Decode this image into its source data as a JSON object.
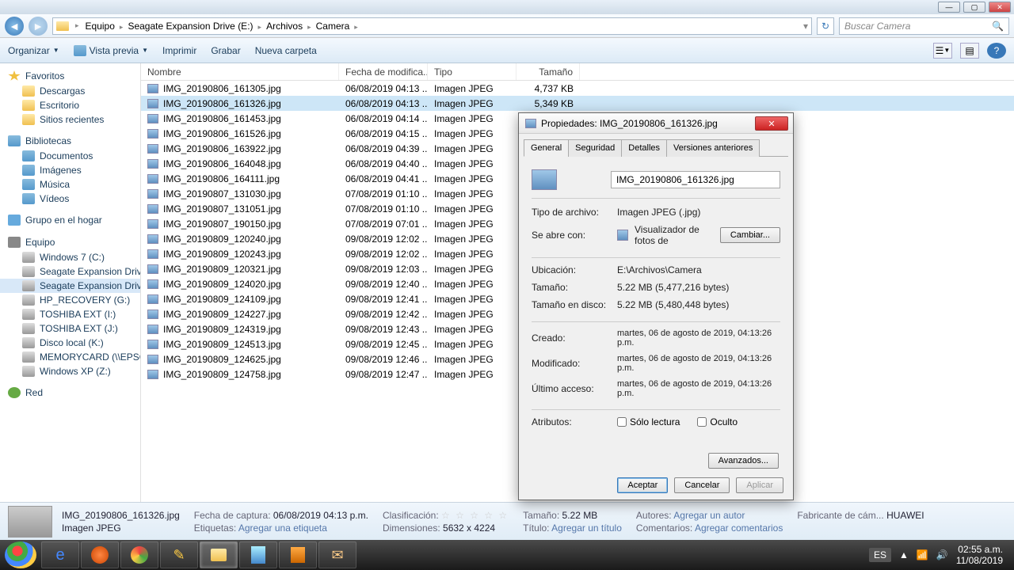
{
  "window": {
    "minimize": "—",
    "maximize": "▢",
    "close": "✕"
  },
  "nav": {
    "back": "◄",
    "fwd": "►",
    "refresh": "↻",
    "search_placeholder": "Buscar Camera",
    "search_icon": "🔍",
    "crumbs": [
      "Equipo",
      "Seagate Expansion Drive (E:)",
      "Archivos",
      "Camera"
    ]
  },
  "toolbar": {
    "organize": "Organizar",
    "preview": "Vista previa",
    "print": "Imprimir",
    "burn": "Grabar",
    "newfolder": "Nueva carpeta",
    "help": "?"
  },
  "sidebar": {
    "favorites": "Favoritos",
    "fav_items": [
      "Descargas",
      "Escritorio",
      "Sitios recientes"
    ],
    "libraries": "Bibliotecas",
    "lib_items": [
      "Documentos",
      "Imágenes",
      "Música",
      "Vídeos"
    ],
    "homegroup": "Grupo en el hogar",
    "computer": "Equipo",
    "comp_items": [
      "Windows 7 (C:)",
      "Seagate Expansion Drive (",
      "Seagate Expansion Drive (",
      "HP_RECOVERY (G:)",
      "TOSHIBA EXT (I:)",
      "TOSHIBA EXT (J:)",
      "Disco local (K:)",
      "MEMORYCARD (\\\\EPSON",
      "Windows XP (Z:)"
    ],
    "network": "Red"
  },
  "columns": {
    "name": "Nombre",
    "date": "Fecha de modifica...",
    "type": "Tipo",
    "size": "Tamaño"
  },
  "files": [
    {
      "name": "IMG_20190806_161305.jpg",
      "date": "06/08/2019 04:13 ...",
      "type": "Imagen JPEG",
      "size": "4,737 KB"
    },
    {
      "name": "IMG_20190806_161326.jpg",
      "date": "06/08/2019 04:13 ...",
      "type": "Imagen JPEG",
      "size": "5,349 KB"
    },
    {
      "name": "IMG_20190806_161453.jpg",
      "date": "06/08/2019 04:14 ...",
      "type": "Imagen JPEG",
      "size": ""
    },
    {
      "name": "IMG_20190806_161526.jpg",
      "date": "06/08/2019 04:15 ...",
      "type": "Imagen JPEG",
      "size": ""
    },
    {
      "name": "IMG_20190806_163922.jpg",
      "date": "06/08/2019 04:39 ...",
      "type": "Imagen JPEG",
      "size": ""
    },
    {
      "name": "IMG_20190806_164048.jpg",
      "date": "06/08/2019 04:40 ...",
      "type": "Imagen JPEG",
      "size": ""
    },
    {
      "name": "IMG_20190806_164111.jpg",
      "date": "06/08/2019 04:41 ...",
      "type": "Imagen JPEG",
      "size": ""
    },
    {
      "name": "IMG_20190807_131030.jpg",
      "date": "07/08/2019 01:10 ...",
      "type": "Imagen JPEG",
      "size": ""
    },
    {
      "name": "IMG_20190807_131051.jpg",
      "date": "07/08/2019 01:10 ...",
      "type": "Imagen JPEG",
      "size": ""
    },
    {
      "name": "IMG_20190807_190150.jpg",
      "date": "07/08/2019 07:01 ...",
      "type": "Imagen JPEG",
      "size": ""
    },
    {
      "name": "IMG_20190809_120240.jpg",
      "date": "09/08/2019 12:02 ...",
      "type": "Imagen JPEG",
      "size": ""
    },
    {
      "name": "IMG_20190809_120243.jpg",
      "date": "09/08/2019 12:02 ...",
      "type": "Imagen JPEG",
      "size": ""
    },
    {
      "name": "IMG_20190809_120321.jpg",
      "date": "09/08/2019 12:03 ...",
      "type": "Imagen JPEG",
      "size": ""
    },
    {
      "name": "IMG_20190809_124020.jpg",
      "date": "09/08/2019 12:40 ...",
      "type": "Imagen JPEG",
      "size": ""
    },
    {
      "name": "IMG_20190809_124109.jpg",
      "date": "09/08/2019 12:41 ...",
      "type": "Imagen JPEG",
      "size": ""
    },
    {
      "name": "IMG_20190809_124227.jpg",
      "date": "09/08/2019 12:42 ...",
      "type": "Imagen JPEG",
      "size": ""
    },
    {
      "name": "IMG_20190809_124319.jpg",
      "date": "09/08/2019 12:43 ...",
      "type": "Imagen JPEG",
      "size": ""
    },
    {
      "name": "IMG_20190809_124513.jpg",
      "date": "09/08/2019 12:45 ...",
      "type": "Imagen JPEG",
      "size": ""
    },
    {
      "name": "IMG_20190809_124625.jpg",
      "date": "09/08/2019 12:46 ...",
      "type": "Imagen JPEG",
      "size": ""
    },
    {
      "name": "IMG_20190809_124758.jpg",
      "date": "09/08/2019 12:47 ...",
      "type": "Imagen JPEG",
      "size": ""
    }
  ],
  "selected_index": 1,
  "details": {
    "filename": "IMG_20190806_161326.jpg",
    "filetype": "Imagen JPEG",
    "capture_label": "Fecha de captura:",
    "capture": "06/08/2019 04:13 p.m.",
    "tags_label": "Etiquetas:",
    "tags": "Agregar una etiqueta",
    "rating_label": "Clasificación:",
    "dimensions_label": "Dimensiones:",
    "dimensions": "5632 x 4224",
    "size_label": "Tamaño:",
    "size": "5.22 MB",
    "title_label": "Título:",
    "title": "Agregar un título",
    "authors_label": "Autores:",
    "authors": "Agregar un autor",
    "comments_label": "Comentarios:",
    "comments": "Agregar comentarios",
    "maker_label": "Fabricante de cám...",
    "maker": "HUAWEI"
  },
  "dialog": {
    "title": "Propiedades: IMG_20190806_161326.jpg",
    "tabs": [
      "General",
      "Seguridad",
      "Detalles",
      "Versiones anteriores"
    ],
    "filename": "IMG_20190806_161326.jpg",
    "filetype_label": "Tipo de archivo:",
    "filetype": "Imagen JPEG (.jpg)",
    "openswith_label": "Se abre con:",
    "openswith": "Visualizador de fotos de",
    "change": "Cambiar...",
    "location_label": "Ubicación:",
    "location": "E:\\Archivos\\Camera",
    "size_label": "Tamaño:",
    "size": "5.22 MB (5,477,216 bytes)",
    "sizedisk_label": "Tamaño en disco:",
    "sizedisk": "5.22 MB (5,480,448 bytes)",
    "created_label": "Creado:",
    "created": "martes, 06 de agosto de 2019, 04:13:26 p.m.",
    "modified_label": "Modificado:",
    "modified": "martes, 06 de agosto de 2019, 04:13:26 p.m.",
    "accessed_label": "Último acceso:",
    "accessed": "martes, 06 de agosto de 2019, 04:13:26 p.m.",
    "attributes_label": "Atributos:",
    "readonly": "Sólo lectura",
    "hidden": "Oculto",
    "advanced": "Avanzados...",
    "ok": "Aceptar",
    "cancel": "Cancelar",
    "apply": "Aplicar"
  },
  "taskbar": {
    "lang": "ES",
    "time": "02:55 a.m.",
    "date": "11/08/2019"
  }
}
